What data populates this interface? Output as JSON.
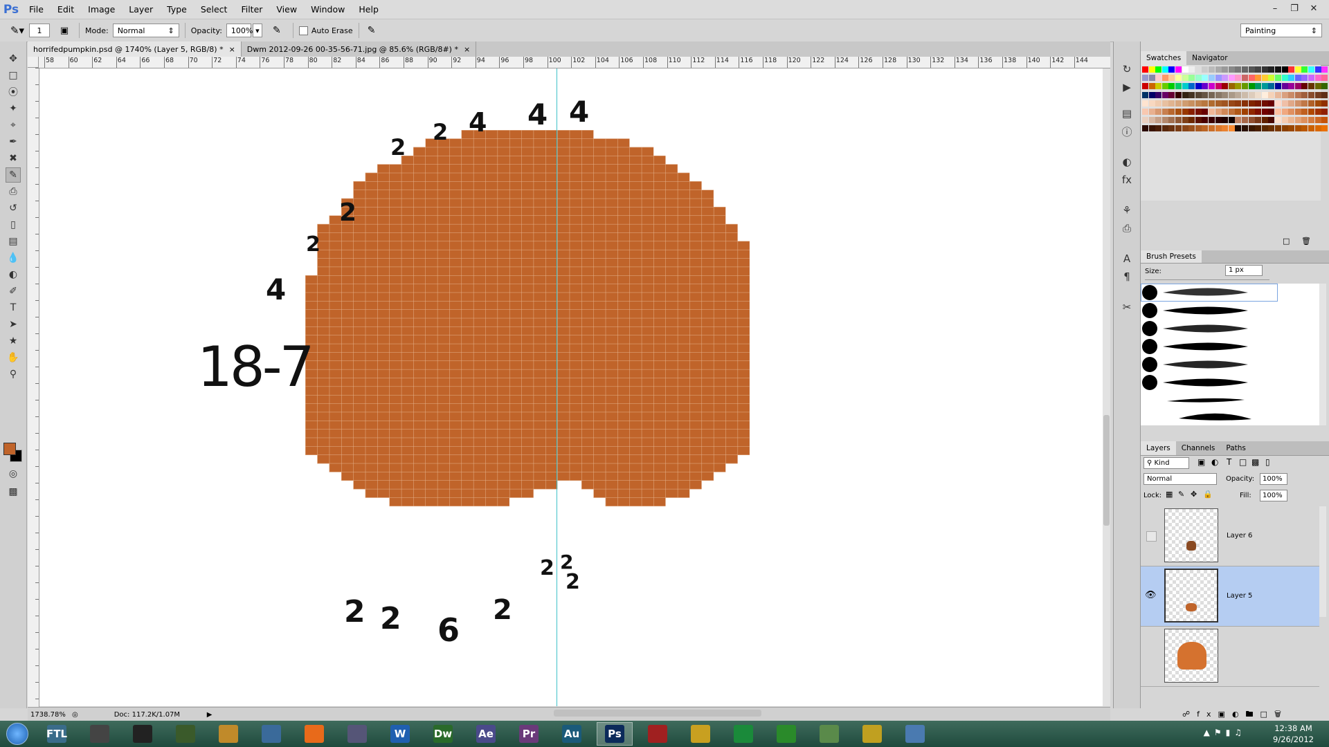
{
  "app": {
    "logo": "Ps",
    "menus": [
      "File",
      "Edit",
      "Image",
      "Layer",
      "Type",
      "Select",
      "Filter",
      "View",
      "Window",
      "Help"
    ]
  },
  "options_bar": {
    "brush_size": "1",
    "mode_label": "Mode:",
    "mode_value": "Normal",
    "opacity_label": "Opacity:",
    "opacity_value": "100%",
    "auto_erase_label": "Auto Erase",
    "workspace": "Painting"
  },
  "doc_tabs": [
    {
      "label": "horrifedpumpkin.psd @ 1740% (Layer 5, RGB/8) *",
      "active": true
    },
    {
      "label": "Dwm 2012-09-26 00-35-56-71.jpg @ 85.6% (RGB/8#) *",
      "active": false
    }
  ],
  "ruler_top_labels": [
    "58",
    "60",
    "62",
    "64",
    "66",
    "68",
    "70",
    "72",
    "74",
    "76",
    "78",
    "80",
    "82",
    "84",
    "86",
    "88",
    "90",
    "92",
    "94",
    "96",
    "98",
    "100",
    "102",
    "104",
    "106",
    "108",
    "110",
    "112",
    "114",
    "116",
    "118",
    "120",
    "122",
    "124",
    "126",
    "128",
    "130",
    "132",
    "134",
    "136",
    "138",
    "140",
    "142",
    "144"
  ],
  "annotations": [
    {
      "text": "4",
      "label": "top-4a"
    },
    {
      "text": "4",
      "label": "top-4b"
    },
    {
      "text": "4",
      "label": "top-4c"
    },
    {
      "text": "2",
      "label": "top-2a"
    },
    {
      "text": "2",
      "label": "top-2b"
    },
    {
      "text": "2",
      "label": "left-2a"
    },
    {
      "text": "2",
      "label": "left-2b"
    },
    {
      "text": "4",
      "label": "left-4"
    },
    {
      "text": "18-7",
      "label": "left-18-7"
    },
    {
      "text": "2",
      "label": "bottom-2a"
    },
    {
      "text": "2",
      "label": "bottom-2b"
    },
    {
      "text": "6",
      "label": "bottom-6"
    },
    {
      "text": "2",
      "label": "bottom-2c"
    },
    {
      "text": "2",
      "label": "bottom-2d"
    },
    {
      "text": "2",
      "label": "bottom-2e"
    },
    {
      "text": "2",
      "label": "bottom-2f"
    }
  ],
  "status": {
    "zoom": "1738.78%",
    "doc": "Doc: 117.2K/1.07M"
  },
  "swatches_panel": {
    "tabs": [
      "Swatches",
      "Navigator"
    ]
  },
  "brush_panel": {
    "title": "Brush Presets",
    "size_label": "Size:",
    "size_value": "1 px"
  },
  "layers_panel": {
    "tabs": [
      "Layers",
      "Channels",
      "Paths"
    ],
    "filter": "Kind",
    "blend_mode": "Normal",
    "opacity_label": "Opacity:",
    "opacity_value": "100%",
    "lock_label": "Lock:",
    "fill_label": "Fill:",
    "fill_value": "100%",
    "layers": [
      {
        "name": "Layer 6",
        "visible": false,
        "selected": false
      },
      {
        "name": "Layer 5",
        "visible": true,
        "selected": true
      },
      {
        "name": "",
        "visible": false,
        "selected": false
      }
    ]
  },
  "taskbar": {
    "icons": [
      "FTL",
      "",
      "",
      "",
      "",
      "",
      "",
      "",
      "W",
      "Dw",
      "Ae",
      "Pr",
      "Au",
      "Ps",
      "",
      "",
      "",
      "",
      "",
      "",
      ""
    ],
    "time": "12:38 AM",
    "date": "9/26/2012"
  },
  "colors": {
    "pumpkin": "#c0642a",
    "pumpkin_grid": "#e4b38e",
    "guide": "#3fc0c8",
    "layer_selected": "#b5cdf2"
  }
}
